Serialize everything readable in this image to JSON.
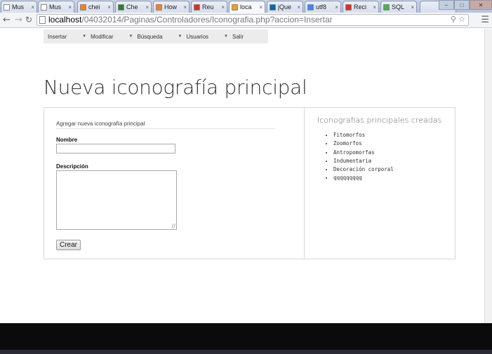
{
  "browser": {
    "tabs": [
      {
        "title": "Mus",
        "icon": "page-icon",
        "color": "#ffffff"
      },
      {
        "title": "Mus",
        "icon": "page-icon",
        "color": "#ffffff"
      },
      {
        "title": "chei",
        "icon": "stackoverflow-icon",
        "color": "#f48024"
      },
      {
        "title": "Che",
        "icon": "terminal-icon",
        "color": "#2e7d32"
      },
      {
        "title": "How",
        "icon": "stackoverflow-icon",
        "color": "#f48024"
      },
      {
        "title": "Reu",
        "icon": "gmail-icon",
        "color": "#d93025"
      },
      {
        "title": "loca",
        "icon": "phpmyadmin-icon",
        "color": "#f0a020"
      },
      {
        "title": "jQue",
        "icon": "jquery-icon",
        "color": "#0769ad"
      },
      {
        "title": "utf8",
        "icon": "google-icon",
        "color": "#4285f4"
      },
      {
        "title": "Reci",
        "icon": "gmail-icon",
        "color": "#d93025"
      },
      {
        "title": "SQL",
        "icon": "w3schools-icon",
        "color": "#4caf50"
      },
      {
        "title": "",
        "icon": "",
        "color": "#ffffff"
      }
    ],
    "active_tab_index": 6,
    "url_host": "localhost",
    "url_path": "/04032014/Paginas/Controladores/Iconografia.php?accion=Insertar"
  },
  "site_menu": [
    {
      "label": "Insertar"
    },
    {
      "label": "Modificar"
    },
    {
      "label": "Búsqueda"
    },
    {
      "label": "Usuarios"
    },
    {
      "label": "Salir"
    }
  ],
  "page": {
    "title": "Nueva iconografía principal"
  },
  "form": {
    "heading": "Agregar nueva iconografía principal",
    "nombre_label": "Nombre",
    "nombre_value": "",
    "descripcion_label": "Descripción",
    "descripcion_value": "",
    "submit_label": "Crear"
  },
  "sidebar": {
    "title": "Iconografias principales creadas",
    "items": [
      "Fitomorfos",
      "Zoomorfos",
      "Antropomorfas",
      "Indumentaria",
      "Decoración corporal",
      "qqqqqqqqq"
    ]
  }
}
